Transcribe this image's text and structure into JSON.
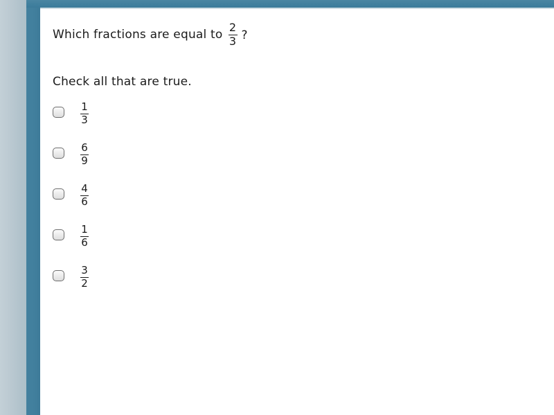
{
  "theme": {
    "accent_teal": "#41809e",
    "left_strip_light": "#c3d0d7",
    "left_strip_dark": "#aec0ca",
    "panel_background": "#ffffff",
    "text_color": "#1b1b1b",
    "checkbox_border": "#6d6d6d"
  },
  "question": {
    "prompt_text": "Which fractions are equal to",
    "fraction": {
      "numerator": "2",
      "denominator": "3"
    },
    "terminator": "?"
  },
  "instruction": {
    "text": "Check all that are true."
  },
  "options": [
    {
      "numerator": "1",
      "denominator": "3",
      "checked": false
    },
    {
      "numerator": "6",
      "denominator": "9",
      "checked": false
    },
    {
      "numerator": "4",
      "denominator": "6",
      "checked": false
    },
    {
      "numerator": "1",
      "denominator": "6",
      "checked": false
    },
    {
      "numerator": "3",
      "denominator": "2",
      "checked": false
    }
  ]
}
